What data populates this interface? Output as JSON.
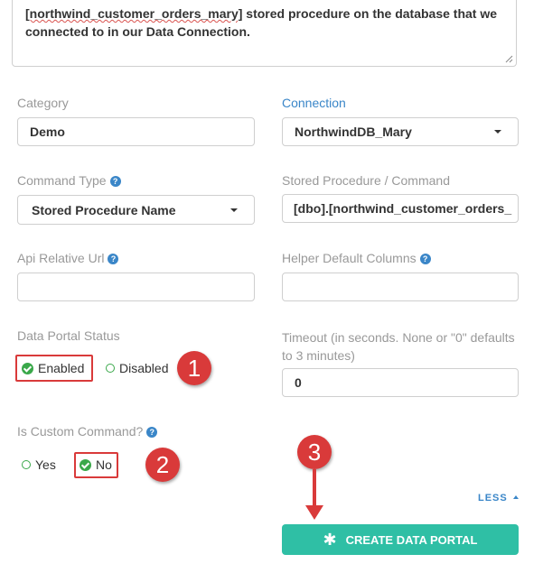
{
  "description": {
    "line1_tail": "stored procedure on the database that we",
    "line1_name": "[northwind_customer_orders_mary]",
    "line2": "connected to in our Data Connection."
  },
  "category": {
    "label": "Category",
    "value": "Demo"
  },
  "connection": {
    "label": "Connection",
    "value": "NorthwindDB_Mary"
  },
  "command_type": {
    "label": "Command Type",
    "value": "Stored Procedure Name"
  },
  "stored_procedure": {
    "label": "Stored Procedure / Command",
    "value": "[dbo].[northwind_customer_orders_"
  },
  "api_relative_url": {
    "label": "Api Relative Url",
    "value": ""
  },
  "helper_default_columns": {
    "label": "Helper Default Columns",
    "value": ""
  },
  "data_portal_status": {
    "label": "Data Portal Status",
    "options": [
      "Enabled",
      "Disabled"
    ],
    "selected": "Enabled"
  },
  "timeout": {
    "label_line1": "Timeout (in seconds. None or \"0\" defaults",
    "label_line2": "to 3 minutes)",
    "value": "0"
  },
  "is_custom_command": {
    "label": "Is Custom Command?",
    "options": [
      "Yes",
      "No"
    ],
    "selected": "No"
  },
  "annotations": [
    "1",
    "2",
    "3"
  ],
  "less_label": "LESS",
  "create_button": {
    "label": "CREATE DATA PORTAL",
    "icon": "asterisk-icon"
  },
  "colors": {
    "accent_blue": "#3a86c8",
    "teal": "#2fbfa5",
    "green": "#3aa84a",
    "red": "#d93a3a"
  }
}
